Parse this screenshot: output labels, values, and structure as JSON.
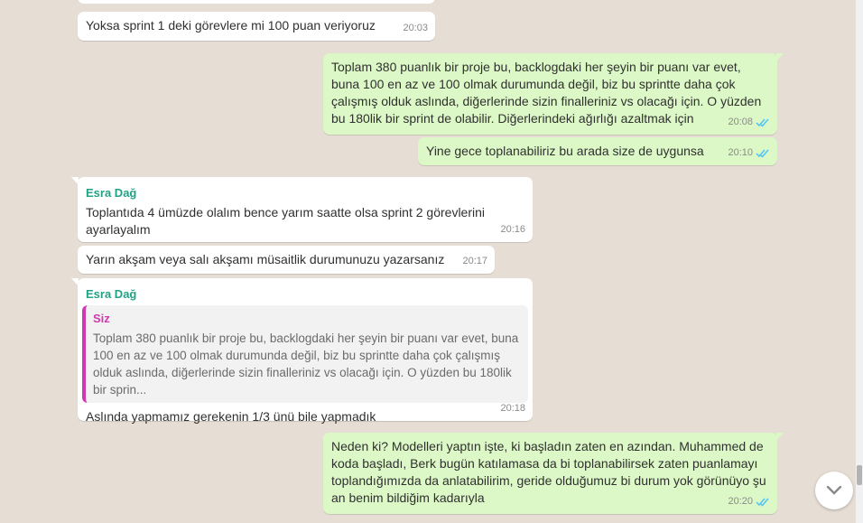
{
  "messages": [
    {
      "text": "Yoksa sprint 1 deki görevlere mi 100 puan veriyoruz",
      "time": "20:03"
    },
    {
      "text": "Toplam 380 puanlık bir proje bu, backlogdaki her şeyin bir puanı var evet, buna 100 en az ve 100 olmak durumunda değil, biz bu sprintte daha çok çalışmış olduk aslında, diğerlerinde sizin finalleriniz vs olacağı için. O yüzden bu 180lik bir sprint de olabilir. Diğerlerindeki ağırlığı azaltmak için",
      "time": "20:08"
    },
    {
      "text": "Yine gece toplanabiliriz bu arada size de uygunsa",
      "time": "20:10"
    },
    {
      "sender": "Esra Dağ",
      "text": "Toplantıda 4 ümüzde olalım bence yarım saatte olsa sprint 2 görevlerini ayarlayalım",
      "time": "20:16"
    },
    {
      "text": "Yarın akşam veya salı akşamı müsaitlik durumunuzu yazarsanız",
      "time": "20:17"
    },
    {
      "sender": "Esra Dağ",
      "quote_sender": "Siz",
      "quote_text": "Toplam 380 puanlık bir proje bu, backlogdaki her şeyin bir puanı var evet, buna 100 en az ve 100 olmak durumunda değil, biz bu sprintte daha çok çalışmış olduk aslında, diğerlerinde sizin finalleriniz vs olacağı için. O yüzden bu 180lik bir sprin...",
      "text": "Aslında yapmamız gerekenin 1/3 ünü bile yapmadık",
      "time": "20:18"
    },
    {
      "text": "Neden ki? Modelleri yaptın işte, ki başladın zaten en azından. Muhammed de koda başladı, Berk bugün katılamasa da bi toplanabilirsek zaten puanlamayı toplandığımızda da anlatabilirim, geride olduğumuz bi durum yok görünüyo şu an benim bildiğim kadarıyla",
      "time": "20:20"
    }
  ],
  "icons": {
    "read": "double-check-icon",
    "scroll": "chevron-down-icon"
  },
  "colors": {
    "incoming": "#ffffff",
    "outgoing": "#dcf8c6",
    "sender": "#1fa385",
    "quote_accent": "#cf38b1",
    "tick": "#4fc3f7"
  }
}
